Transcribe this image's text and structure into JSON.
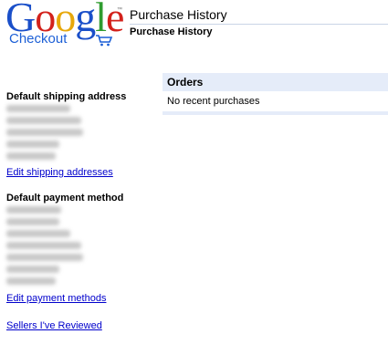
{
  "logo": {
    "letters": [
      "G",
      "o",
      "o",
      "g",
      "l",
      "e"
    ],
    "sub": "Checkout",
    "tm": "™",
    "icon": "shopping-cart-icon",
    "colors": [
      "#1a4fc9",
      "#d3221c",
      "#e7a80b",
      "#1a4fc9",
      "#2f9c2f",
      "#d3221c"
    ]
  },
  "header": {
    "title": "Purchase History",
    "subtitle": "Purchase History"
  },
  "shipping": {
    "heading": "Default shipping address",
    "link": "Edit shipping addresses"
  },
  "payment": {
    "heading": "Default payment method",
    "link": "Edit payment methods"
  },
  "sellers_link": "Sellers I've Reviewed",
  "orders": {
    "heading": "Orders",
    "empty_text": "No recent purchases",
    "accent": "#e5ecf9"
  },
  "link_color": "#0000cc"
}
